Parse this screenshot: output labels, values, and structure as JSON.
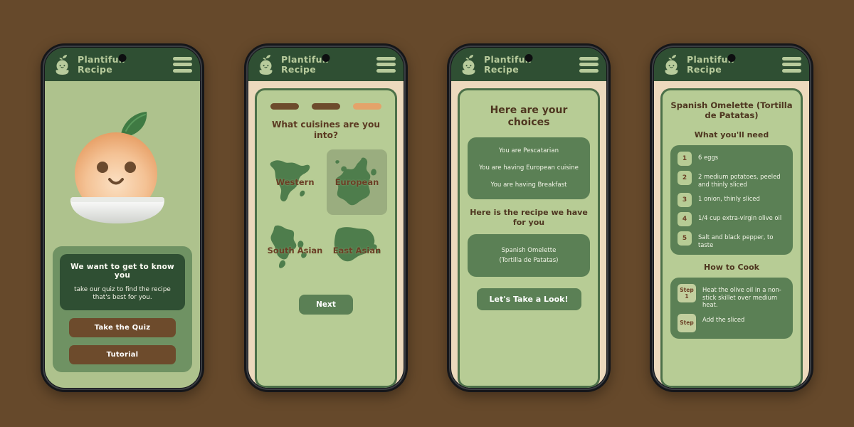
{
  "background_color": "#66492b",
  "app": {
    "brand_name": "Plantifull\nRecipe",
    "logo_icon": "sprout-pot-icon",
    "menu_icon": "hamburger-menu-icon"
  },
  "screens": [
    {
      "id": "welcome",
      "hero_icon": "orange-mascot-in-bowl-icon",
      "panel": {
        "heading": "We want to get to know you",
        "subtext": "take our quiz to find the recipe that's best for you.",
        "buttons": [
          {
            "label": "Take the Quiz",
            "name": "take-the-quiz-button"
          },
          {
            "label": "Tutorial",
            "name": "tutorial-button"
          }
        ]
      }
    },
    {
      "id": "cuisine-quiz",
      "progress": [
        {
          "state": "done",
          "color": "#6d4b2c"
        },
        {
          "state": "done",
          "color": "#6d4b2c"
        },
        {
          "state": "active",
          "color": "#e4a36a"
        }
      ],
      "question": "What cuisines are you into?",
      "options": [
        {
          "label": "Western",
          "icon": "north-america-map-icon",
          "selected": false
        },
        {
          "label": "European",
          "icon": "europe-map-icon",
          "selected": true
        },
        {
          "label": "South Asian",
          "icon": "south-asia-map-icon",
          "selected": false
        },
        {
          "label": "East Asian",
          "icon": "east-asia-map-icon",
          "selected": false
        }
      ],
      "next_label": "Next"
    },
    {
      "id": "choices-summary",
      "title": "Here are your choices",
      "choices": [
        "You are Pescatarian",
        "You are having European cuisine",
        "You are having Breakfast"
      ],
      "recipe_heading": "Here is the recipe we have for you",
      "recipe_name_line1": "Spanish Omelette",
      "recipe_name_line2": "(Tortilla de Patatas)",
      "cta_label": "Let's Take a Look!"
    },
    {
      "id": "recipe-detail",
      "title": "Spanish Omelette (Tortilla de Patatas)",
      "ingredients_heading": "What you'll need",
      "ingredients": [
        {
          "num": "1",
          "text": "6 eggs"
        },
        {
          "num": "2",
          "text": "2 medium potatoes, peeled and thinly sliced"
        },
        {
          "num": "3",
          "text": "1 onion, thinly sliced"
        },
        {
          "num": "4",
          "text": "1/4 cup extra-virgin olive oil"
        },
        {
          "num": "5",
          "text": "Salt and black pepper, to taste"
        }
      ],
      "steps_heading": "How to Cook",
      "steps": [
        {
          "label": "Step 1",
          "text": "Heat the olive oil in a non-stick skillet over medium heat."
        },
        {
          "label": "Step",
          "text": "Add the sliced"
        }
      ]
    }
  ]
}
